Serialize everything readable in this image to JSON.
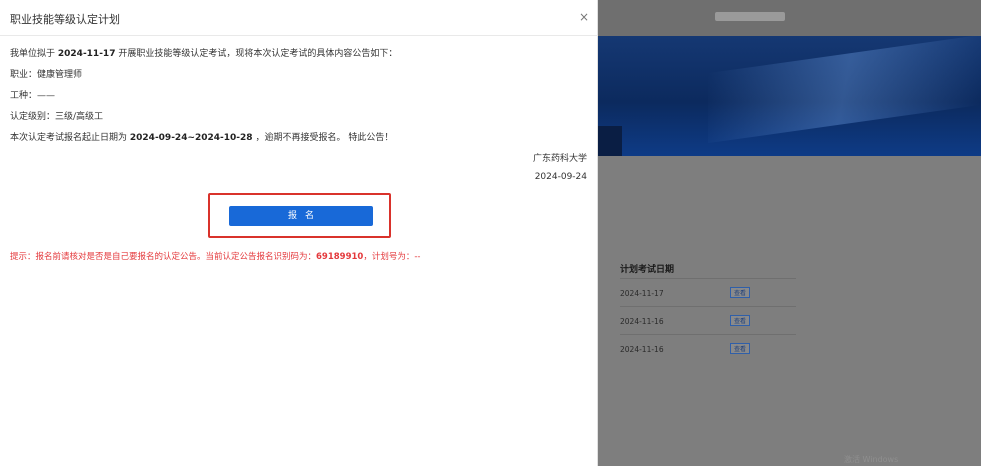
{
  "modal": {
    "title": "职业技能等级认定计划",
    "close_label": "×",
    "intro_pre": "我单位拟于",
    "exam_date": "2024-11-17",
    "intro_post": "开展职业技能等级认定考试，现将本次认定考试的具体内容公告如下：",
    "occupation": "职业：健康管理师",
    "work_type": "工种：——",
    "level": "认定级别：三级/高级工",
    "period_pre": "本次认定考试报名起止日期为",
    "period": "2024-09-24~2024-10-28",
    "period_post": "，逾期不再接受报名。 特此公告！",
    "org": "广东药科大学",
    "pub_date": "2024-09-24",
    "register_label": "报名",
    "tip_pre": "提示：报名前请核对是否是自己要报名的认定公告。当前认定公告报名识别码为：",
    "tip_code": "69189910",
    "tip_post": "，计划号为：--"
  },
  "background": {
    "card_title": "计划考试日期",
    "rows": [
      {
        "date": "2024-11-17",
        "btn": "查看"
      },
      {
        "date": "2024-11-16",
        "btn": "查看"
      },
      {
        "date": "2024-11-16",
        "btn": "查看"
      }
    ],
    "watermark": "激活 Windows"
  },
  "colors": {
    "primary": "#1869d8",
    "highlight_border": "#d9322b",
    "tip": "#e4393c",
    "overlay": "#7e7e7e"
  }
}
